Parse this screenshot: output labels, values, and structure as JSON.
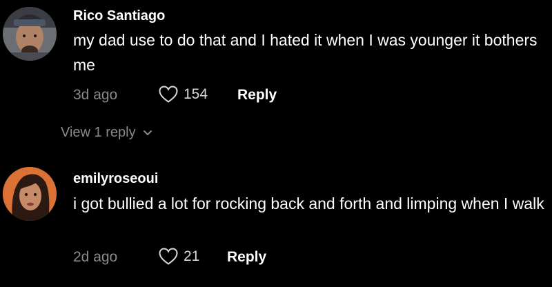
{
  "comments": [
    {
      "username": "Rico Santiago",
      "text": "my dad use to do that and I hated it when I was younger it bothers me",
      "time": "3d ago",
      "likes": "154",
      "reply_label": "Reply",
      "view_replies_label": "View 1 reply"
    },
    {
      "username": "emilyroseoui",
      "text": "i got bullied a lot for rocking back and forth and limping when I walk",
      "time": "2d ago",
      "likes": "21",
      "reply_label": "Reply"
    }
  ],
  "colors": {
    "background": "#000000",
    "primary_text": "#ffffff",
    "secondary_text": "#8a8a8a"
  }
}
